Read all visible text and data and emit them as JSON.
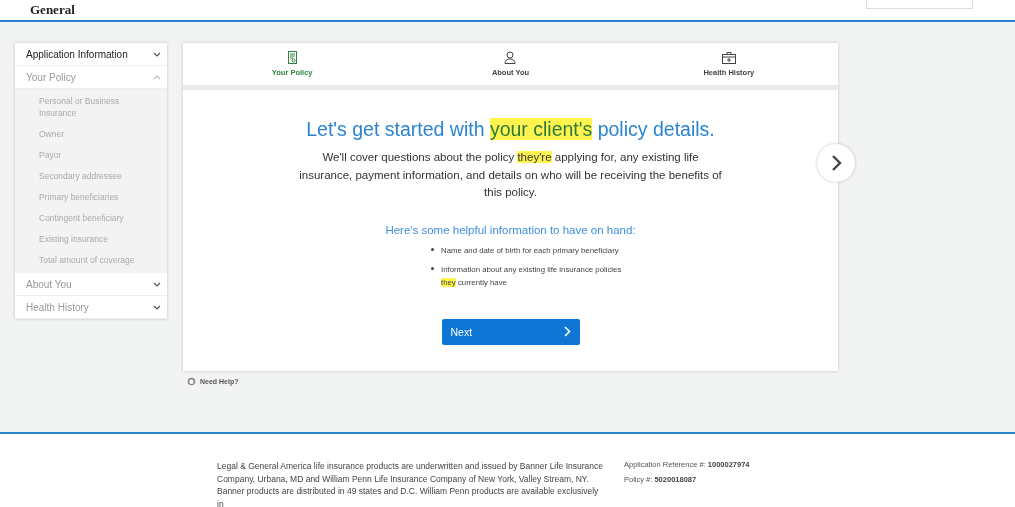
{
  "header": {
    "logo": "General"
  },
  "sidebar": {
    "sections": [
      {
        "label": "Application Information",
        "expanded": false,
        "active": true
      },
      {
        "label": "Your Policy",
        "expanded": true,
        "active": false,
        "children": [
          {
            "label": "Personal or Business Insurance"
          },
          {
            "label": "Owner"
          },
          {
            "label": "Payor"
          },
          {
            "label": "Secondary addressee"
          },
          {
            "label": "Primary beneficiaries"
          },
          {
            "label": "Contingent beneficiary"
          },
          {
            "label": "Existing insurance"
          },
          {
            "label": "Total amount of coverage"
          }
        ]
      },
      {
        "label": "About You",
        "expanded": false,
        "active": false
      },
      {
        "label": "Health History",
        "expanded": false,
        "active": false
      }
    ]
  },
  "tabs": [
    {
      "label": "Your Policy",
      "kind": "document",
      "selected": true
    },
    {
      "label": "About You",
      "kind": "person",
      "selected": false
    },
    {
      "label": "Health History",
      "kind": "medkit",
      "selected": false
    }
  ],
  "intro": {
    "heading": [
      {
        "text": "Let's get started with ",
        "highlighted": false
      },
      {
        "text": "your client's",
        "highlighted": true
      },
      {
        "text": " policy details.",
        "highlighted": false
      }
    ],
    "body": [
      {
        "text": "We'll cover questions about the policy ",
        "highlighted": false
      },
      {
        "text": "they're",
        "highlighted": true
      },
      {
        "text": " applying for, any existing life insurance, payment information, and details on who will be receiving the benefits of this policy.",
        "highlighted": false
      }
    ],
    "subheading": "Here's some helpful information to have on hand:",
    "bullets": [
      [
        {
          "text": "Name and date of birth for each primary beneficiary",
          "highlighted": false
        }
      ],
      [
        {
          "text": "Information about any existing life insurance policies ",
          "highlighted": false
        },
        {
          "text": "they",
          "highlighted": true
        },
        {
          "text": " currently have",
          "highlighted": false
        }
      ]
    ],
    "next_button": "Next"
  },
  "need_help": "Need Help?",
  "footer": {
    "disclaimer": "Legal & General America life insurance products are underwritten and issued by Banner Life Insurance Company, Urbana, MD and William Penn Life Insurance Company of New York, Valley Stream, NY. Banner products are distributed in 49 states and D.C. William Penn products are available exclusively in",
    "references": [
      {
        "label": "Application Reference #:",
        "value": "1000027974"
      },
      {
        "label": "Policy #:",
        "value": "5020018087"
      }
    ]
  }
}
